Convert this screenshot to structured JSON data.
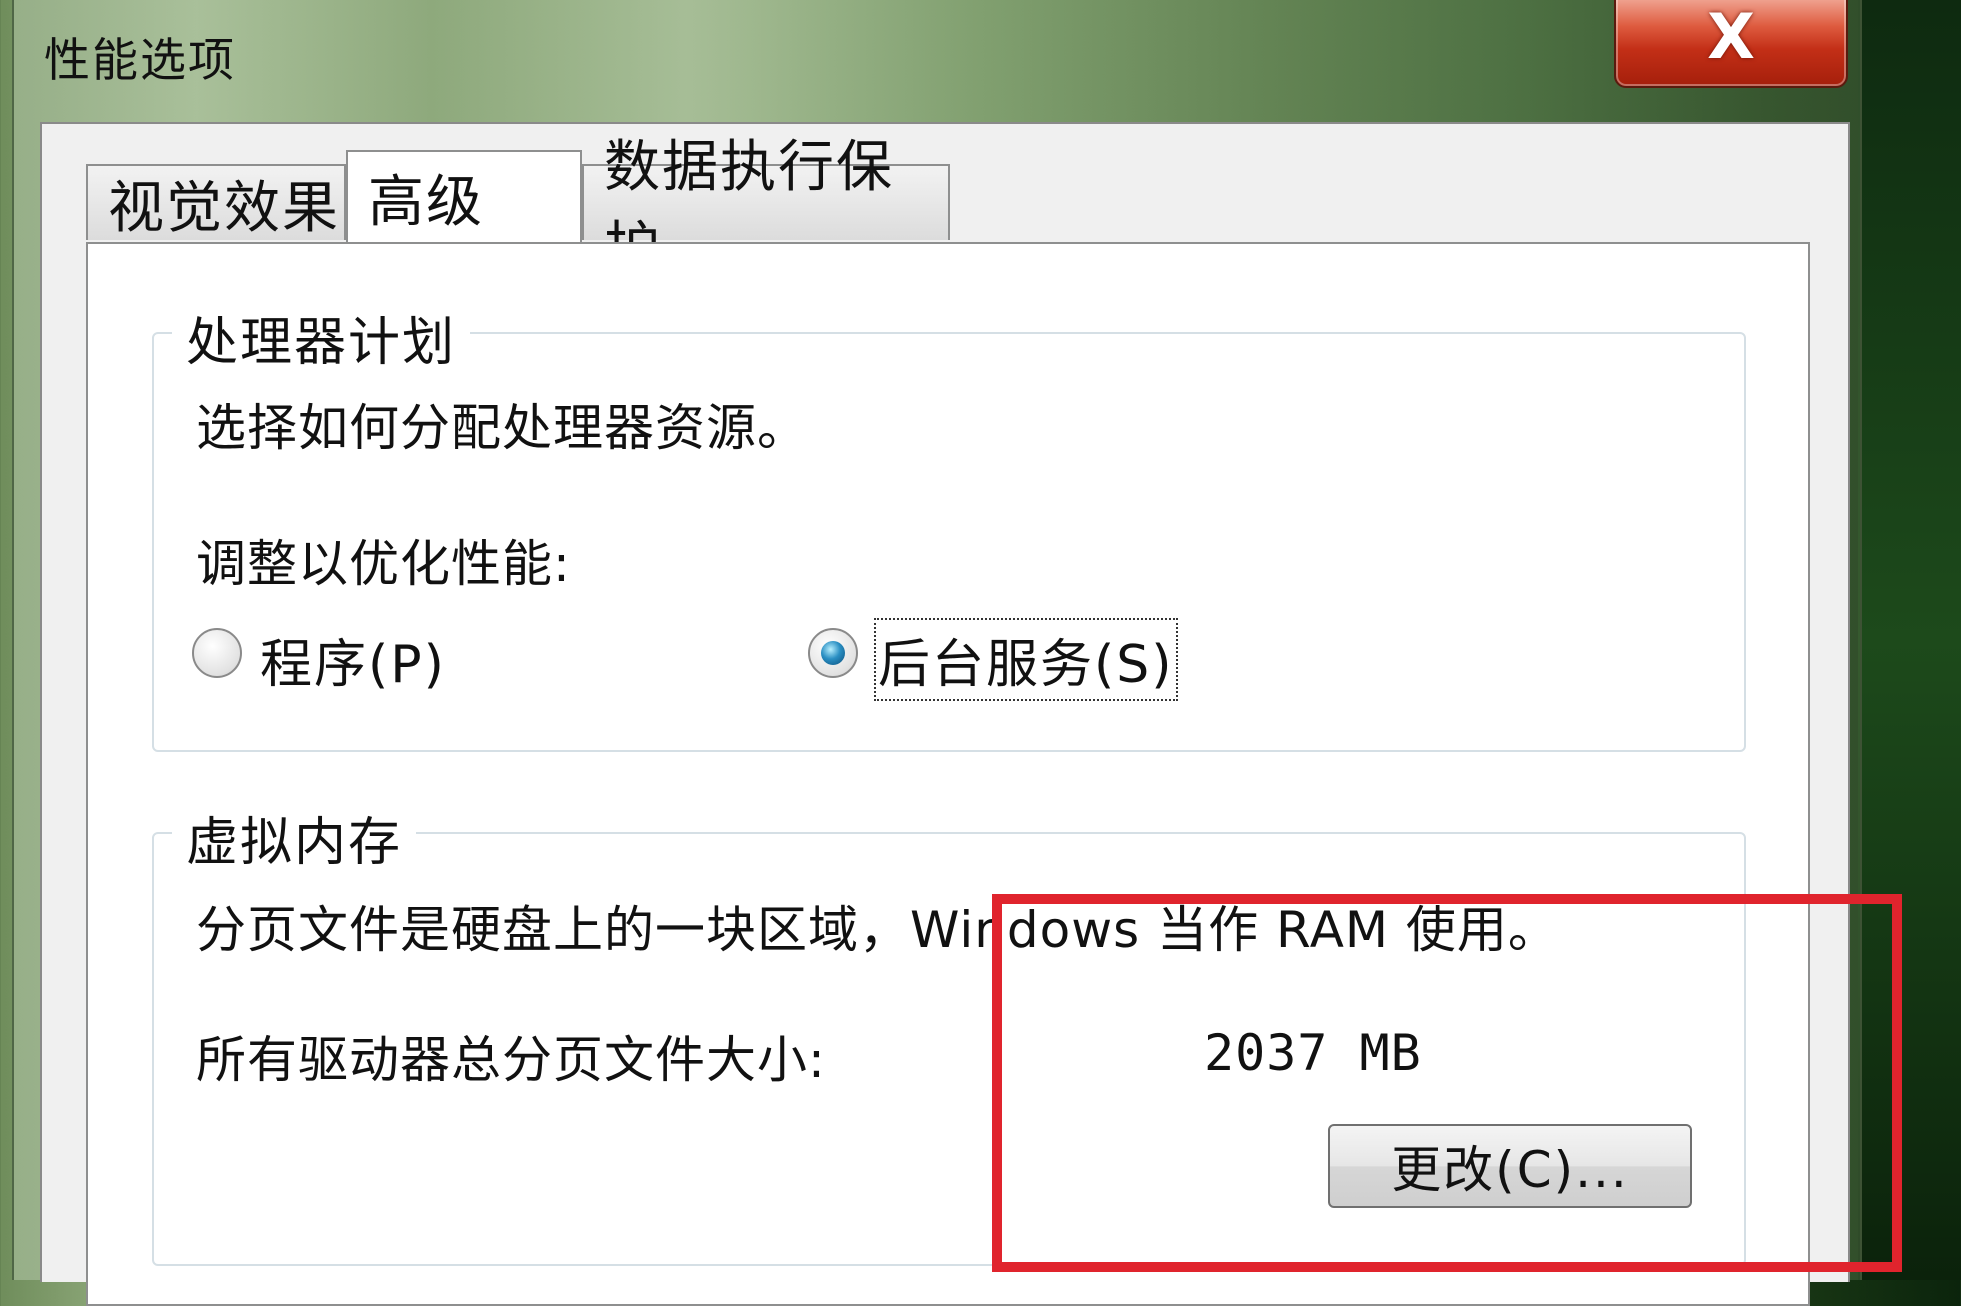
{
  "window": {
    "title": "性能选项",
    "close_icon": "close-icon",
    "close_glyph": "X"
  },
  "tabs": [
    {
      "label": "视觉效果",
      "active": false
    },
    {
      "label": "高级",
      "active": true
    },
    {
      "label": "数据执行保护",
      "active": false
    }
  ],
  "processor": {
    "group_title": "处理器计划",
    "description": "选择如何分配处理器资源。",
    "adjust_label": "调整以优化性能:",
    "options": [
      {
        "label": "程序(P)",
        "checked": false
      },
      {
        "label": "后台服务(S)",
        "checked": true
      }
    ]
  },
  "virtual_memory": {
    "group_title": "虚拟内存",
    "description": "分页文件是硬盘上的一块区域，Windows 当作 RAM 使用。",
    "total_label": "所有驱动器总分页文件大小:",
    "total_value": "2037 MB",
    "change_button": "更改(C)..."
  },
  "colors": {
    "highlight_border": "#e0242d",
    "close_button": "#c32f17",
    "radio_selected": "#2a8fc3"
  }
}
